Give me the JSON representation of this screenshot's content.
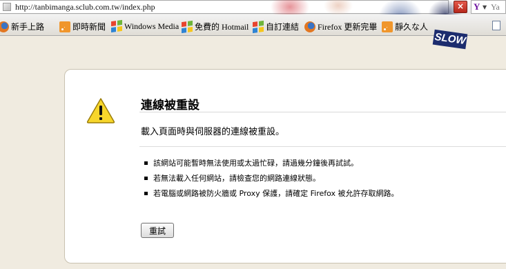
{
  "address_bar": {
    "url": "http://tanbimanga.sclub.com.tw/index.php"
  },
  "stop_button": {
    "label": "×"
  },
  "search": {
    "engine_mark": "Y",
    "placeholder_text": "Ya"
  },
  "persona_banner": {
    "text": "SLOW"
  },
  "bookmarks": [
    {
      "label": "新手上路",
      "icon": "firefox-icon"
    },
    {
      "label": "即時新聞",
      "icon": "rss-icon"
    },
    {
      "label": "Windows Media",
      "icon": "windows-icon"
    },
    {
      "label": "免費的 Hotmail",
      "icon": "windows-icon"
    },
    {
      "label": "自訂連結",
      "icon": "windows-icon"
    },
    {
      "label": "Firefox 更新完畢",
      "icon": "firefox-icon"
    },
    {
      "label": "靜久な人",
      "icon": "rss-icon"
    }
  ],
  "error_page": {
    "title": "連線被重設",
    "subtitle": "載入頁面時與伺服器的連線被重設。",
    "reasons": [
      "該網站可能暫時無法使用或太過忙碌，請過幾分鐘後再試試。",
      "若無法載入任何網站，請檢查您的網路連線狀態。",
      "若電腦或網路被防火牆或 Proxy 保護，請確定 Firefox 被允許存取網路。"
    ],
    "try_again_label": "重試"
  },
  "colors": {
    "page_background": "#f0ebe0",
    "card_background": "#ffffff",
    "warning_yellow": "#f7d62b",
    "stop_red": "#c9362a",
    "yahoo_purple": "#6b0f9e"
  }
}
